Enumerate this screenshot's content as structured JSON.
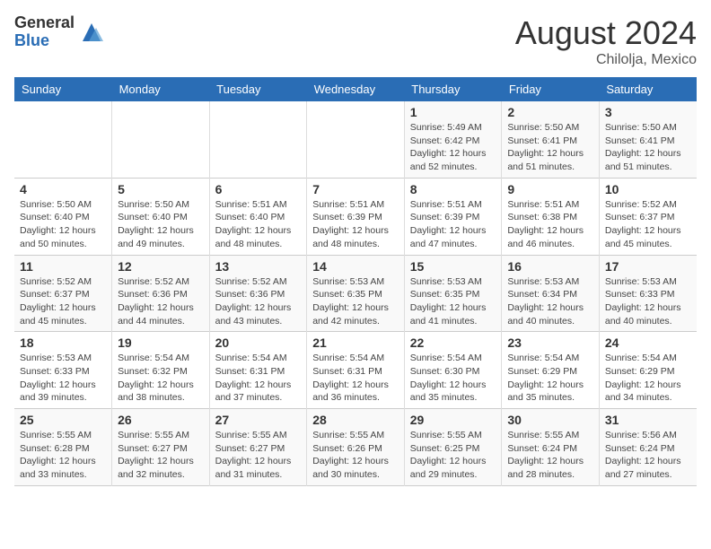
{
  "logo": {
    "general": "General",
    "blue": "Blue"
  },
  "title": "August 2024",
  "location": "Chilolja, Mexico",
  "weekdays": [
    "Sunday",
    "Monday",
    "Tuesday",
    "Wednesday",
    "Thursday",
    "Friday",
    "Saturday"
  ],
  "weeks": [
    [
      {
        "day": "",
        "info": ""
      },
      {
        "day": "",
        "info": ""
      },
      {
        "day": "",
        "info": ""
      },
      {
        "day": "",
        "info": ""
      },
      {
        "day": "1",
        "info": "Sunrise: 5:49 AM\nSunset: 6:42 PM\nDaylight: 12 hours\nand 52 minutes."
      },
      {
        "day": "2",
        "info": "Sunrise: 5:50 AM\nSunset: 6:41 PM\nDaylight: 12 hours\nand 51 minutes."
      },
      {
        "day": "3",
        "info": "Sunrise: 5:50 AM\nSunset: 6:41 PM\nDaylight: 12 hours\nand 51 minutes."
      }
    ],
    [
      {
        "day": "4",
        "info": "Sunrise: 5:50 AM\nSunset: 6:40 PM\nDaylight: 12 hours\nand 50 minutes."
      },
      {
        "day": "5",
        "info": "Sunrise: 5:50 AM\nSunset: 6:40 PM\nDaylight: 12 hours\nand 49 minutes."
      },
      {
        "day": "6",
        "info": "Sunrise: 5:51 AM\nSunset: 6:40 PM\nDaylight: 12 hours\nand 48 minutes."
      },
      {
        "day": "7",
        "info": "Sunrise: 5:51 AM\nSunset: 6:39 PM\nDaylight: 12 hours\nand 48 minutes."
      },
      {
        "day": "8",
        "info": "Sunrise: 5:51 AM\nSunset: 6:39 PM\nDaylight: 12 hours\nand 47 minutes."
      },
      {
        "day": "9",
        "info": "Sunrise: 5:51 AM\nSunset: 6:38 PM\nDaylight: 12 hours\nand 46 minutes."
      },
      {
        "day": "10",
        "info": "Sunrise: 5:52 AM\nSunset: 6:37 PM\nDaylight: 12 hours\nand 45 minutes."
      }
    ],
    [
      {
        "day": "11",
        "info": "Sunrise: 5:52 AM\nSunset: 6:37 PM\nDaylight: 12 hours\nand 45 minutes."
      },
      {
        "day": "12",
        "info": "Sunrise: 5:52 AM\nSunset: 6:36 PM\nDaylight: 12 hours\nand 44 minutes."
      },
      {
        "day": "13",
        "info": "Sunrise: 5:52 AM\nSunset: 6:36 PM\nDaylight: 12 hours\nand 43 minutes."
      },
      {
        "day": "14",
        "info": "Sunrise: 5:53 AM\nSunset: 6:35 PM\nDaylight: 12 hours\nand 42 minutes."
      },
      {
        "day": "15",
        "info": "Sunrise: 5:53 AM\nSunset: 6:35 PM\nDaylight: 12 hours\nand 41 minutes."
      },
      {
        "day": "16",
        "info": "Sunrise: 5:53 AM\nSunset: 6:34 PM\nDaylight: 12 hours\nand 40 minutes."
      },
      {
        "day": "17",
        "info": "Sunrise: 5:53 AM\nSunset: 6:33 PM\nDaylight: 12 hours\nand 40 minutes."
      }
    ],
    [
      {
        "day": "18",
        "info": "Sunrise: 5:53 AM\nSunset: 6:33 PM\nDaylight: 12 hours\nand 39 minutes."
      },
      {
        "day": "19",
        "info": "Sunrise: 5:54 AM\nSunset: 6:32 PM\nDaylight: 12 hours\nand 38 minutes."
      },
      {
        "day": "20",
        "info": "Sunrise: 5:54 AM\nSunset: 6:31 PM\nDaylight: 12 hours\nand 37 minutes."
      },
      {
        "day": "21",
        "info": "Sunrise: 5:54 AM\nSunset: 6:31 PM\nDaylight: 12 hours\nand 36 minutes."
      },
      {
        "day": "22",
        "info": "Sunrise: 5:54 AM\nSunset: 6:30 PM\nDaylight: 12 hours\nand 35 minutes."
      },
      {
        "day": "23",
        "info": "Sunrise: 5:54 AM\nSunset: 6:29 PM\nDaylight: 12 hours\nand 35 minutes."
      },
      {
        "day": "24",
        "info": "Sunrise: 5:54 AM\nSunset: 6:29 PM\nDaylight: 12 hours\nand 34 minutes."
      }
    ],
    [
      {
        "day": "25",
        "info": "Sunrise: 5:55 AM\nSunset: 6:28 PM\nDaylight: 12 hours\nand 33 minutes."
      },
      {
        "day": "26",
        "info": "Sunrise: 5:55 AM\nSunset: 6:27 PM\nDaylight: 12 hours\nand 32 minutes."
      },
      {
        "day": "27",
        "info": "Sunrise: 5:55 AM\nSunset: 6:27 PM\nDaylight: 12 hours\nand 31 minutes."
      },
      {
        "day": "28",
        "info": "Sunrise: 5:55 AM\nSunset: 6:26 PM\nDaylight: 12 hours\nand 30 minutes."
      },
      {
        "day": "29",
        "info": "Sunrise: 5:55 AM\nSunset: 6:25 PM\nDaylight: 12 hours\nand 29 minutes."
      },
      {
        "day": "30",
        "info": "Sunrise: 5:55 AM\nSunset: 6:24 PM\nDaylight: 12 hours\nand 28 minutes."
      },
      {
        "day": "31",
        "info": "Sunrise: 5:56 AM\nSunset: 6:24 PM\nDaylight: 12 hours\nand 27 minutes."
      }
    ]
  ]
}
